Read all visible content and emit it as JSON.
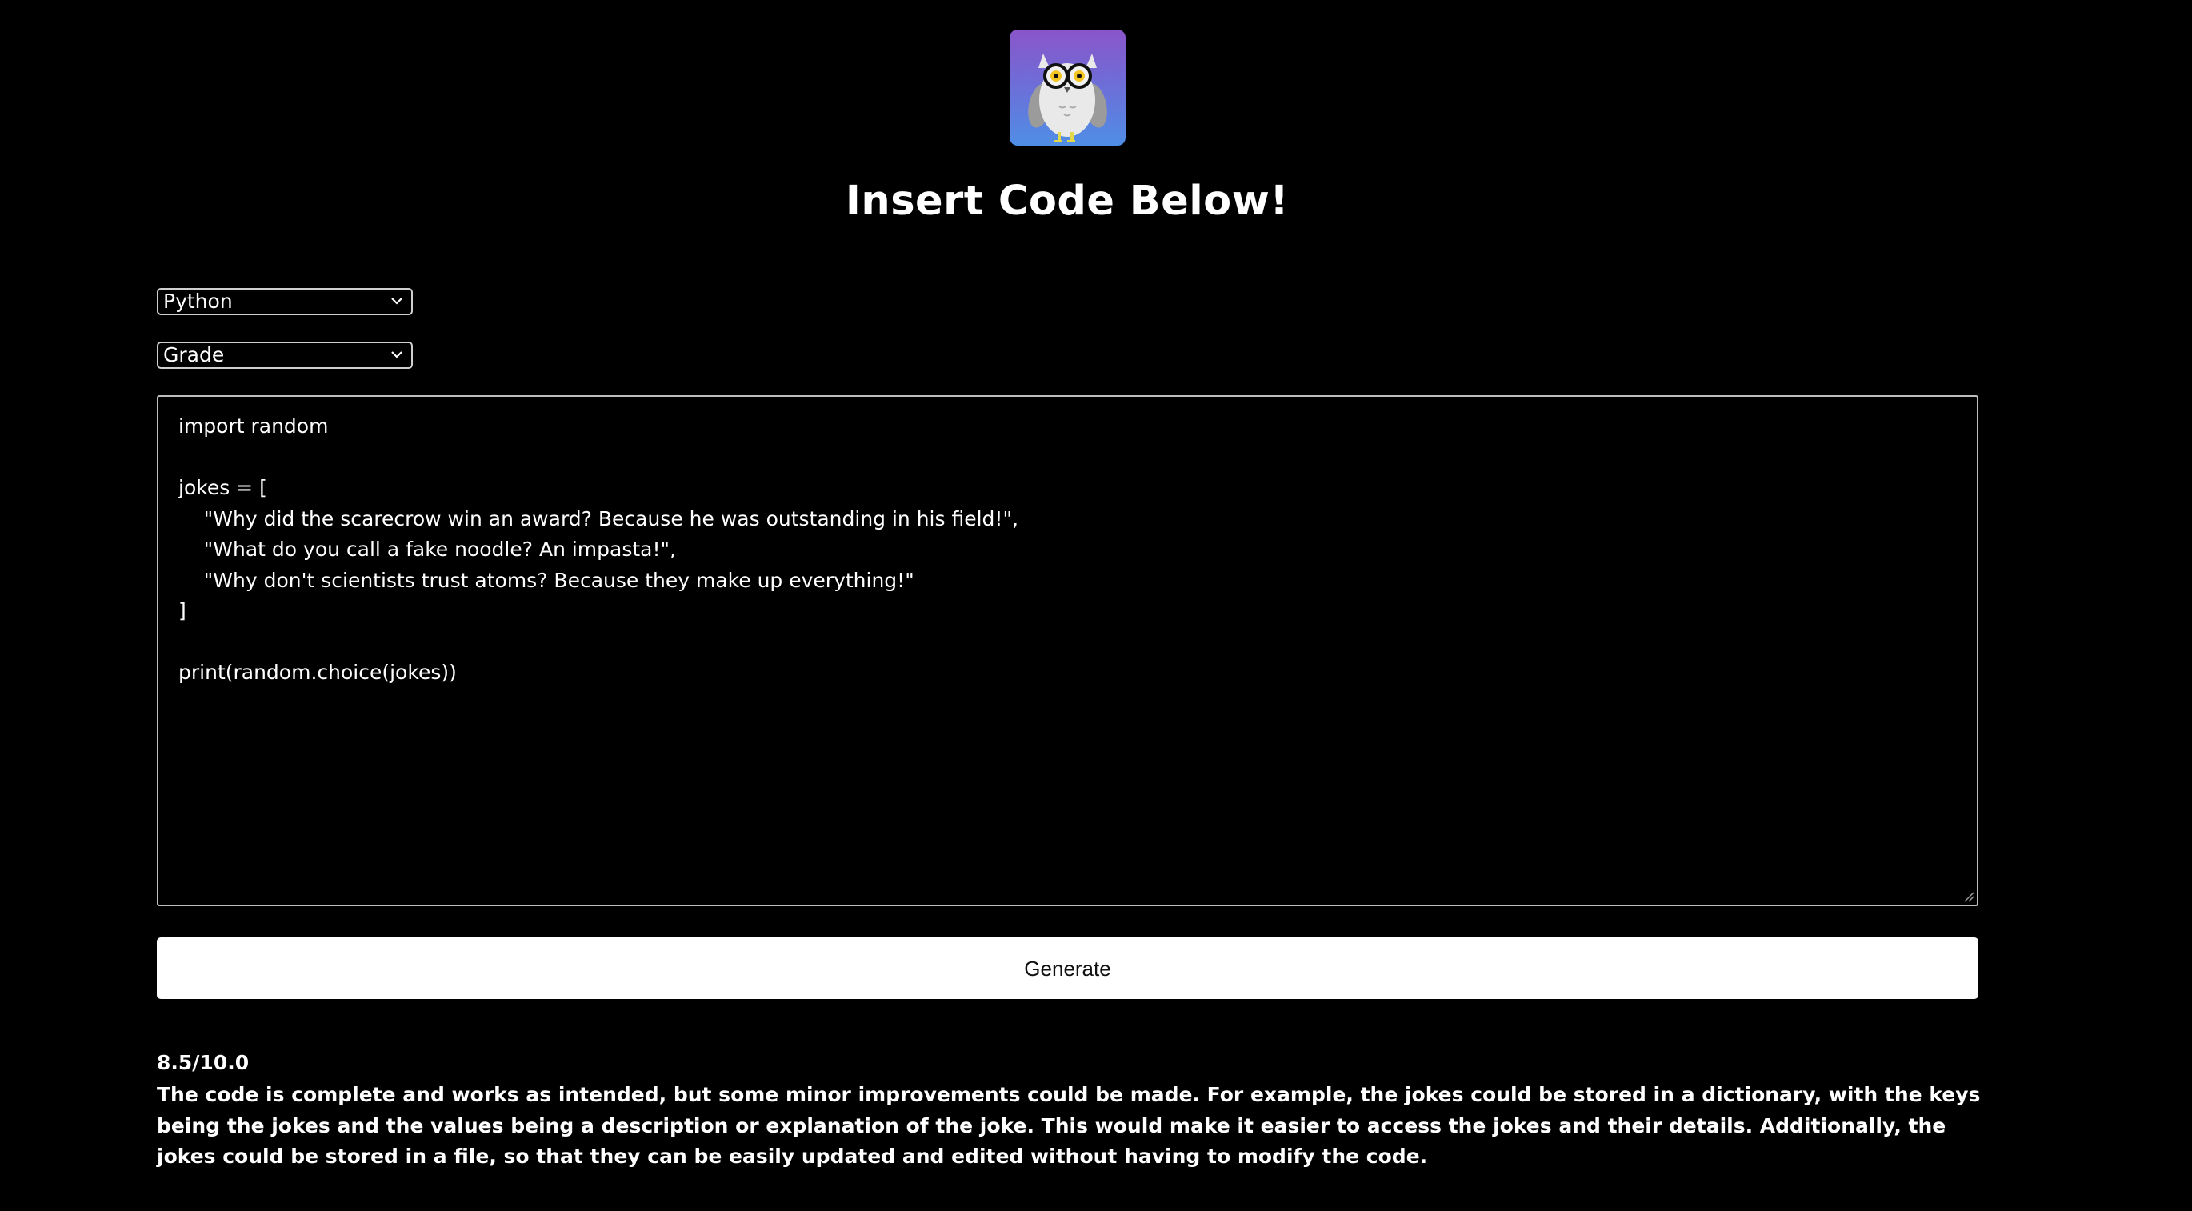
{
  "header": {
    "title": "Insert Code Below!"
  },
  "controls": {
    "language_select": "Python",
    "mode_select": "Grade",
    "generate_label": "Generate"
  },
  "editor": {
    "code": "import random\n\njokes = [\n    \"Why did the scarecrow win an award? Because he was outstanding in his field!\",\n    \"What do you call a fake noodle? An impasta!\",\n    \"Why don't scientists trust atoms? Because they make up everything!\"\n]\n\nprint(random.choice(jokes))"
  },
  "result": {
    "score": "8.5/10.0",
    "feedback": "The code is complete and works as intended, but some minor improvements could be made. For example, the jokes could be stored in a dictionary, with the keys being the jokes and the values being a description or explanation of the joke. This would make it easier to access the jokes and their details. Additionally, the jokes could be stored in a file, so that they can be easily updated and edited without having to modify the code."
  },
  "icons": {
    "logo": "owl-with-glasses-icon",
    "dropdown": "chevron-down-icon",
    "resize": "resize-grip-icon"
  },
  "colors": {
    "background": "#000000",
    "text": "#ffffff",
    "button_bg": "#ffffff",
    "logo_gradient_top": "#8a55c9",
    "logo_gradient_bottom": "#4f8ee6"
  }
}
